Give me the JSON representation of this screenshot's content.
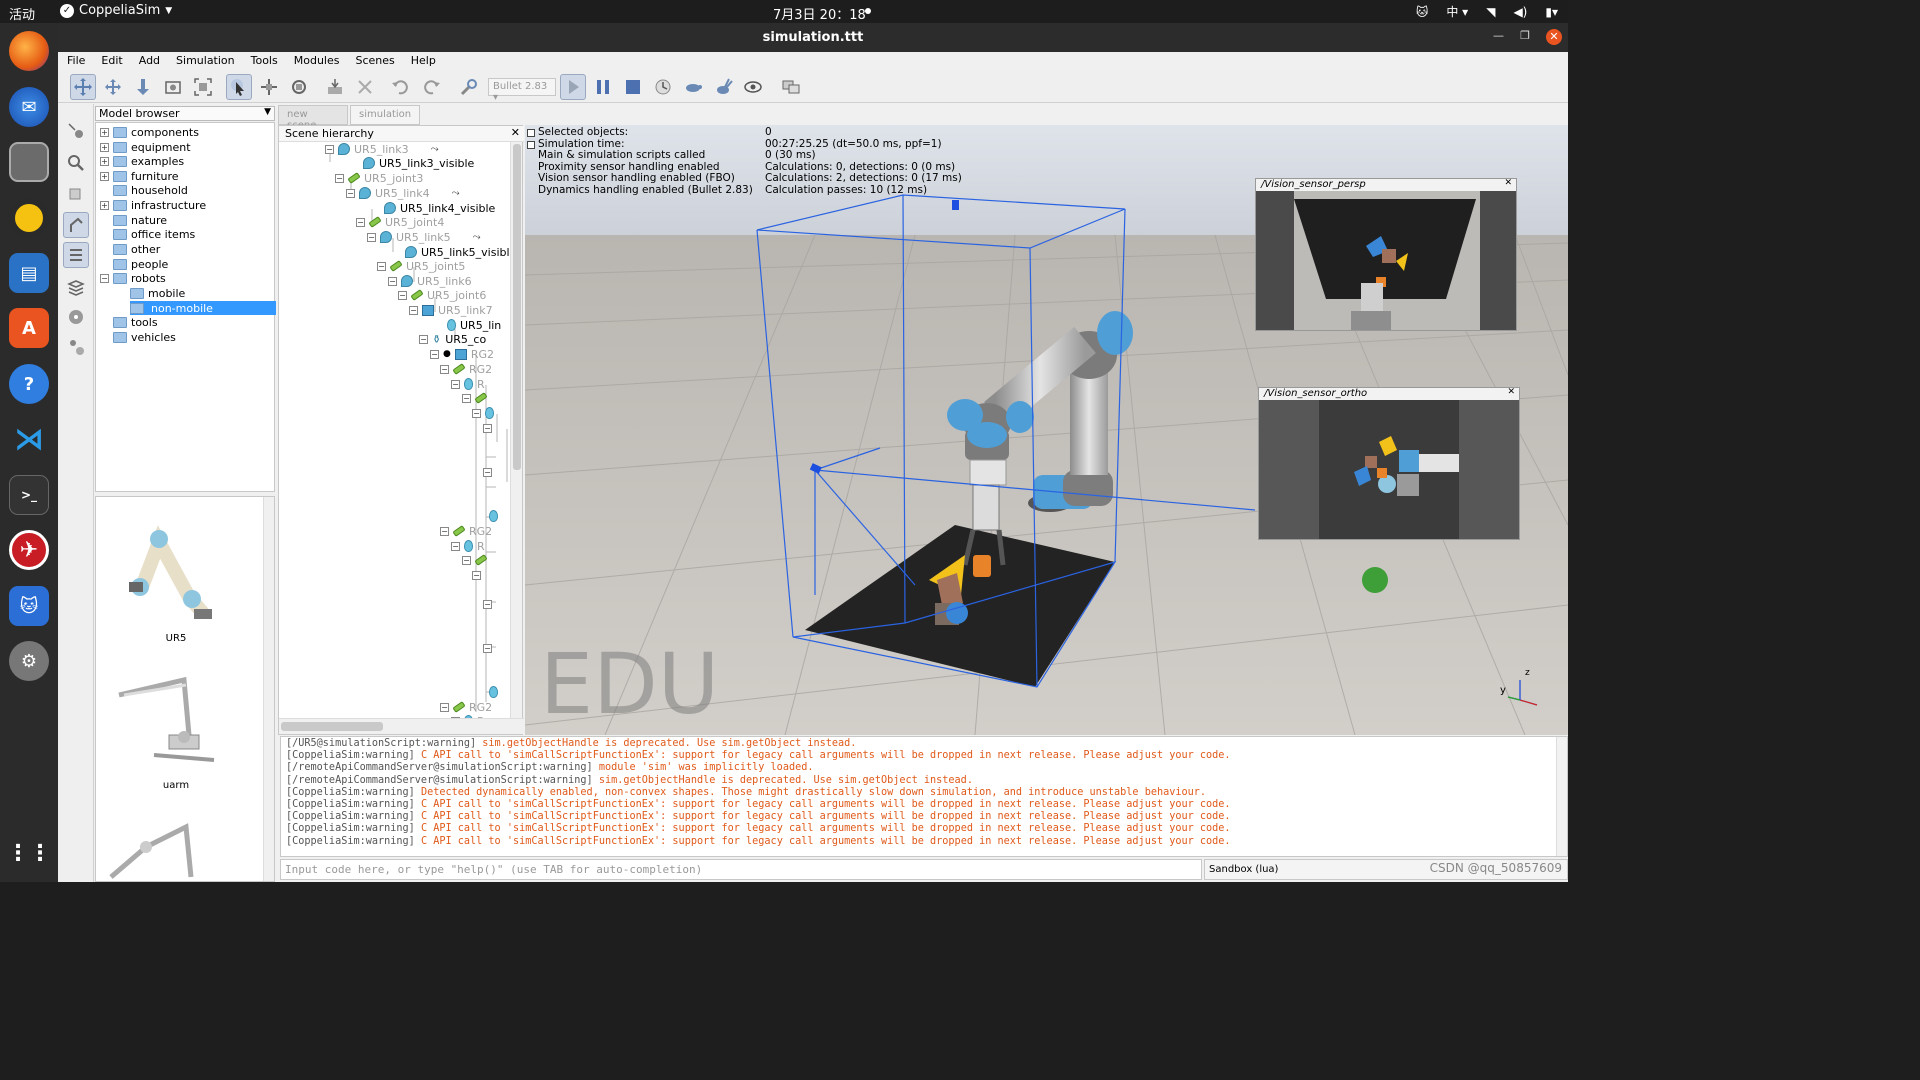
{
  "topbar": {
    "activities": "活动",
    "app_name": "CoppeliaSim",
    "clock": "7月3日  20：18",
    "input_method": "中"
  },
  "window": {
    "title": "simulation.ttt",
    "buttons": [
      "minimize",
      "maximize",
      "close"
    ]
  },
  "menu": [
    "File",
    "Edit",
    "Add",
    "Simulation",
    "Tools",
    "Modules",
    "Scenes",
    "Help"
  ],
  "toolbar": {
    "engine": "Bullet 2.83"
  },
  "model_browser": {
    "title": "Model browser",
    "items": [
      {
        "label": "components",
        "expander": "+"
      },
      {
        "label": "equipment",
        "expander": "+"
      },
      {
        "label": "examples",
        "expander": "+"
      },
      {
        "label": "furniture",
        "expander": "+"
      },
      {
        "label": "household",
        "expander": ""
      },
      {
        "label": "infrastructure",
        "expander": "+"
      },
      {
        "label": "nature",
        "expander": ""
      },
      {
        "label": "office items",
        "expander": ""
      },
      {
        "label": "other",
        "expander": ""
      },
      {
        "label": "people",
        "expander": ""
      },
      {
        "label": "robots",
        "expander": "−"
      },
      {
        "label": "mobile",
        "expander": ""
      },
      {
        "label": "non-mobile",
        "expander": "",
        "selected": true
      },
      {
        "label": "tools",
        "expander": ""
      },
      {
        "label": "vehicles",
        "expander": ""
      }
    ],
    "thumbnails": [
      "UR5",
      "uarm"
    ]
  },
  "scene_tabs": [
    "new scene",
    "simulation"
  ],
  "scene_hierarchy": {
    "title": "Scene hierarchy",
    "items": [
      {
        "label": "UR5_link3",
        "type": "shape",
        "dim": true
      },
      {
        "label": "UR5_link3_visible",
        "type": "shape",
        "dim": false
      },
      {
        "label": "UR5_joint3",
        "type": "joint",
        "dim": true
      },
      {
        "label": "UR5_link4",
        "type": "shape",
        "dim": true
      },
      {
        "label": "UR5_link4_visible",
        "type": "shape",
        "dim": false
      },
      {
        "label": "UR5_joint4",
        "type": "joint",
        "dim": true
      },
      {
        "label": "UR5_link5",
        "type": "shape",
        "dim": true
      },
      {
        "label": "UR5_link5_visibl",
        "type": "shape",
        "dim": false
      },
      {
        "label": "UR5_joint5",
        "type": "joint",
        "dim": true
      },
      {
        "label": "UR5_link6",
        "type": "shape",
        "dim": true
      },
      {
        "label": "UR5_joint6",
        "type": "joint",
        "dim": true
      },
      {
        "label": "UR5_link7",
        "type": "cube",
        "dim": true
      },
      {
        "label": "UR5_lin",
        "type": "drop",
        "dim": false
      },
      {
        "label": "UR5_co",
        "type": "joint",
        "dim": false
      },
      {
        "label": "RG2",
        "type": "cube",
        "dim": true
      },
      {
        "label": "RG2",
        "type": "joint",
        "dim": true
      },
      {
        "label": "R",
        "type": "drop",
        "dim": true
      },
      {
        "label": "RG2",
        "type": "joint",
        "dim": true
      },
      {
        "label": "R",
        "type": "drop",
        "dim": true
      },
      {
        "label": "RG2",
        "type": "joint",
        "dim": true
      },
      {
        "label": "R",
        "type": "drop",
        "dim": true
      }
    ]
  },
  "viewport": {
    "info": [
      {
        "key": "Selected objects:",
        "value": "0"
      },
      {
        "key": "Simulation time:",
        "value": "00:27:25.25 (dt=50.0 ms, ppf=1)"
      },
      {
        "key": "Main & simulation scripts called",
        "value": "0 (30 ms)"
      },
      {
        "key": "Proximity sensor handling enabled",
        "value": "Calculations: 0, detections: 0 (0 ms)"
      },
      {
        "key": "Vision sensor handling enabled (FBO)",
        "value": "Calculations: 2, detections: 0 (17 ms)"
      },
      {
        "key": "Dynamics handling enabled (Bullet 2.83)",
        "value": "Calculation passes: 10 (12 ms)"
      }
    ],
    "watermark": "EDU",
    "vision_sensor_persp": "/Vision_sensor_persp",
    "vision_sensor_ortho": "/Vision_sensor_ortho",
    "axis_y": "y",
    "axis_z": "z",
    "colors": {
      "robot_blue": "#4f9fd6",
      "floor": "#c8c4bf",
      "box": "#1f5fe0"
    }
  },
  "console": [
    {
      "src": "[/UR5@simulationScript:warning]",
      "msg": "sim.getObjectHandle is deprecated. Use sim.getObject instead."
    },
    {
      "src": "[CoppeliaSim:warning]",
      "msg": "C API call to 'simCallScriptFunctionEx': support for legacy call arguments will be dropped in next release. Please adjust your code."
    },
    {
      "src": "[/remoteApiCommandServer@simulationScript:warning]",
      "msg": "module 'sim' was implicitly loaded."
    },
    {
      "src": "[/remoteApiCommandServer@simulationScript:warning]",
      "msg": "sim.getObjectHandle is deprecated. Use sim.getObject instead."
    },
    {
      "src": "[CoppeliaSim:warning]",
      "msg": "Detected dynamically enabled, non-convex shapes. Those might drastically slow down simulation, and introduce unstable behaviour."
    },
    {
      "src": "[CoppeliaSim:warning]",
      "msg": "C API call to 'simCallScriptFunctionEx': support for legacy call arguments will be dropped in next release. Please adjust your code."
    },
    {
      "src": "[CoppeliaSim:warning]",
      "msg": "C API call to 'simCallScriptFunctionEx': support for legacy call arguments will be dropped in next release. Please adjust your code."
    },
    {
      "src": "[CoppeliaSim:warning]",
      "msg": "C API call to 'simCallScriptFunctionEx': support for legacy call arguments will be dropped in next release. Please adjust your code."
    },
    {
      "src": "[CoppeliaSim:warning]",
      "msg": "C API call to 'simCallScriptFunctionEx': support for legacy call arguments will be dropped in next release. Please adjust your code."
    }
  ],
  "command_input": {
    "placeholder": "Input code here, or type \"help()\" (use TAB for auto-completion)"
  },
  "sandbox": "Sandbox (lua)",
  "csdn": "CSDN @qq_50857609"
}
